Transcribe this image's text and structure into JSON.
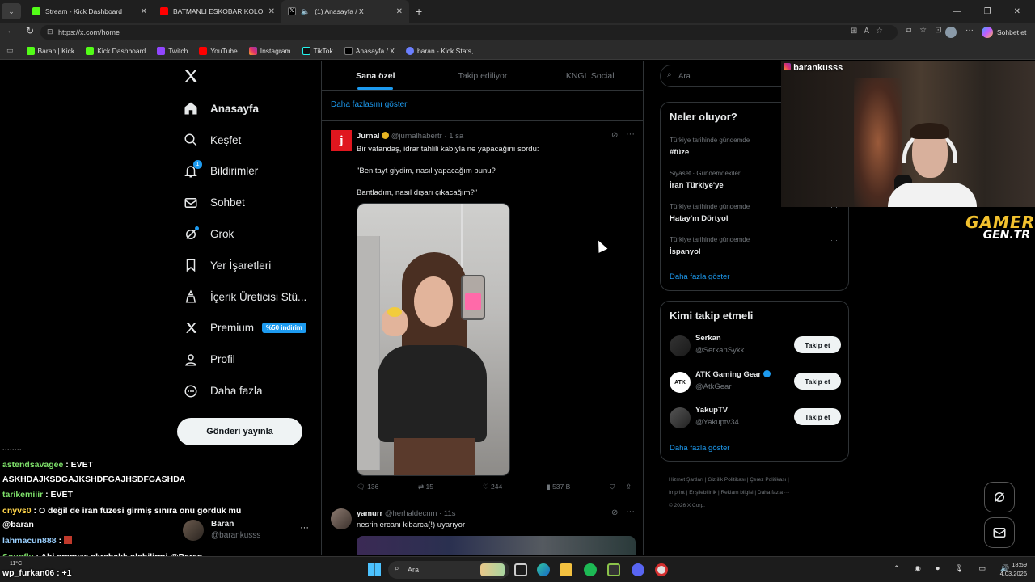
{
  "browser": {
    "tabs": [
      {
        "title": "Stream - Kick Dashboard",
        "color": "#53fc18"
      },
      {
        "title": "BATMANLI ESKOBAR KOLOMBİYA",
        "color": "#ff0000"
      },
      {
        "title": "(1) Anasayfa / X",
        "color": "#ffffff"
      }
    ],
    "url": "https://x.com/home",
    "profile_button": "Sohbet et",
    "bookmarks": [
      "Baran | Kick",
      "Kick Dashboard",
      "Twitch",
      "YouTube",
      "Instagram",
      "TikTok",
      "Anasayfa / X",
      "baran - Kick Stats,..."
    ]
  },
  "nav": {
    "items": [
      {
        "label": "Anasayfa",
        "icon": "home-icon"
      },
      {
        "label": "Keşfet",
        "icon": "search-icon"
      },
      {
        "label": "Bildirimler",
        "icon": "bell-icon",
        "badge": "1"
      },
      {
        "label": "Sohbet",
        "icon": "mail-icon"
      },
      {
        "label": "Grok",
        "icon": "grok-icon"
      },
      {
        "label": "Yer İşaretleri",
        "icon": "bookmark-icon"
      },
      {
        "label": "İçerik Üreticisi Stü...",
        "icon": "creator-icon"
      },
      {
        "label": "Premium",
        "icon": "x-logo-icon",
        "badge": "%50 indirim"
      },
      {
        "label": "Profil",
        "icon": "person-icon"
      },
      {
        "label": "Daha fazla",
        "icon": "more-icon"
      }
    ],
    "post_button": "Gönderi yayınla",
    "account": {
      "name": "Baran",
      "handle": "@barankusss"
    }
  },
  "feed": {
    "tabs": [
      "Sana özel",
      "Takip ediliyor",
      "KNGL Social"
    ],
    "show_more": "Daha fazlasını göster",
    "posts": [
      {
        "name": "Jurnal",
        "handle": "@jurnalhabertr",
        "time": "· 1 sa",
        "lines": [
          "Bir vatandaş, idrar tahlili kabıyla ne yapacağını sordu:",
          "\"Ben tayt giydim, nasıl yapacağım bunu?",
          "Bantladım, nasıl dışarı çıkacağım?\""
        ],
        "stats": {
          "replies": "136",
          "reposts": "15",
          "likes": "244",
          "views": "537 B"
        }
      },
      {
        "name": "yamurr",
        "handle": "@herhaldecnm",
        "time": "· 11s",
        "lines": [
          "nesrin ercanı kibarca(!) uyarıyor"
        ]
      }
    ]
  },
  "right": {
    "search_placeholder": "Ara",
    "trends_title": "Neler oluyor?",
    "trends": [
      {
        "context": "Türkiye tarihinde gündemde",
        "name": "#füze"
      },
      {
        "context": "Siyaset · Gündemdekiler",
        "name": "İran Türkiye'ye"
      },
      {
        "context": "Türkiye tarihinde gündemde",
        "name": "Hatay'ın Dörtyol"
      },
      {
        "context": "Türkiye tarihinde gündemde",
        "name": "İspanyol"
      }
    ],
    "trends_more": "Daha fazla göster",
    "follow_title": "Kimi takip etmeli",
    "follow": [
      {
        "name": "Serkan",
        "handle": "@SerkanSykk",
        "button": "Takip et"
      },
      {
        "name": "ATK Gaming Gear",
        "handle": "@AtkGear",
        "button": "Takip et"
      },
      {
        "name": "YakupTV",
        "handle": "@Yakuptv34",
        "button": "Takip et"
      }
    ],
    "follow_more": "Daha fazla göster",
    "footer": [
      "Hizmet Şartları",
      "Gizlilik Politikası",
      "Çerez Politikası",
      "Imprint",
      "Erişilebilirlik",
      "Reklam bilgisi",
      "Daha fazla ···",
      "© 2026 X Corp."
    ]
  },
  "overlay": {
    "streamer_tag": "barankusss",
    "brand_line1": "GAMER",
    "brand_line2": "GEN.TR"
  },
  "chat": [
    {
      "user": "astendsavagee",
      "msg": " : EVET",
      "color": "#7ee06a"
    },
    {
      "user": "",
      "msg": "ASKHDAJKSDGAJKSHDFGAJHSDFGASHDA",
      "color": "#ffffff"
    },
    {
      "user": "tarikemiiir",
      "msg": " : EVET",
      "color": "#7ee06a"
    },
    {
      "user": "cnyvs0",
      "msg": " : O değil de iran füzesi girmiş sınıra onu gördük mü",
      "color": "#ffd54a"
    },
    {
      "user": "",
      "msg": "@baran",
      "color": "#ffffff"
    },
    {
      "user": "lahmacun888",
      "msg": " :",
      "color": "#9ad0ff"
    },
    {
      "user": "Soupfly",
      "msg": " : Abi aramıza akrabalık olabilirmi @Baran",
      "color": "#7ee06a"
    },
    {
      "user": "wp_furkan06",
      "msg": " : +1",
      "color": "#ffffff"
    }
  ],
  "taskbar": {
    "search": "Ara",
    "time": "18:59",
    "date": "4.03.2026",
    "weather": "11°C"
  }
}
